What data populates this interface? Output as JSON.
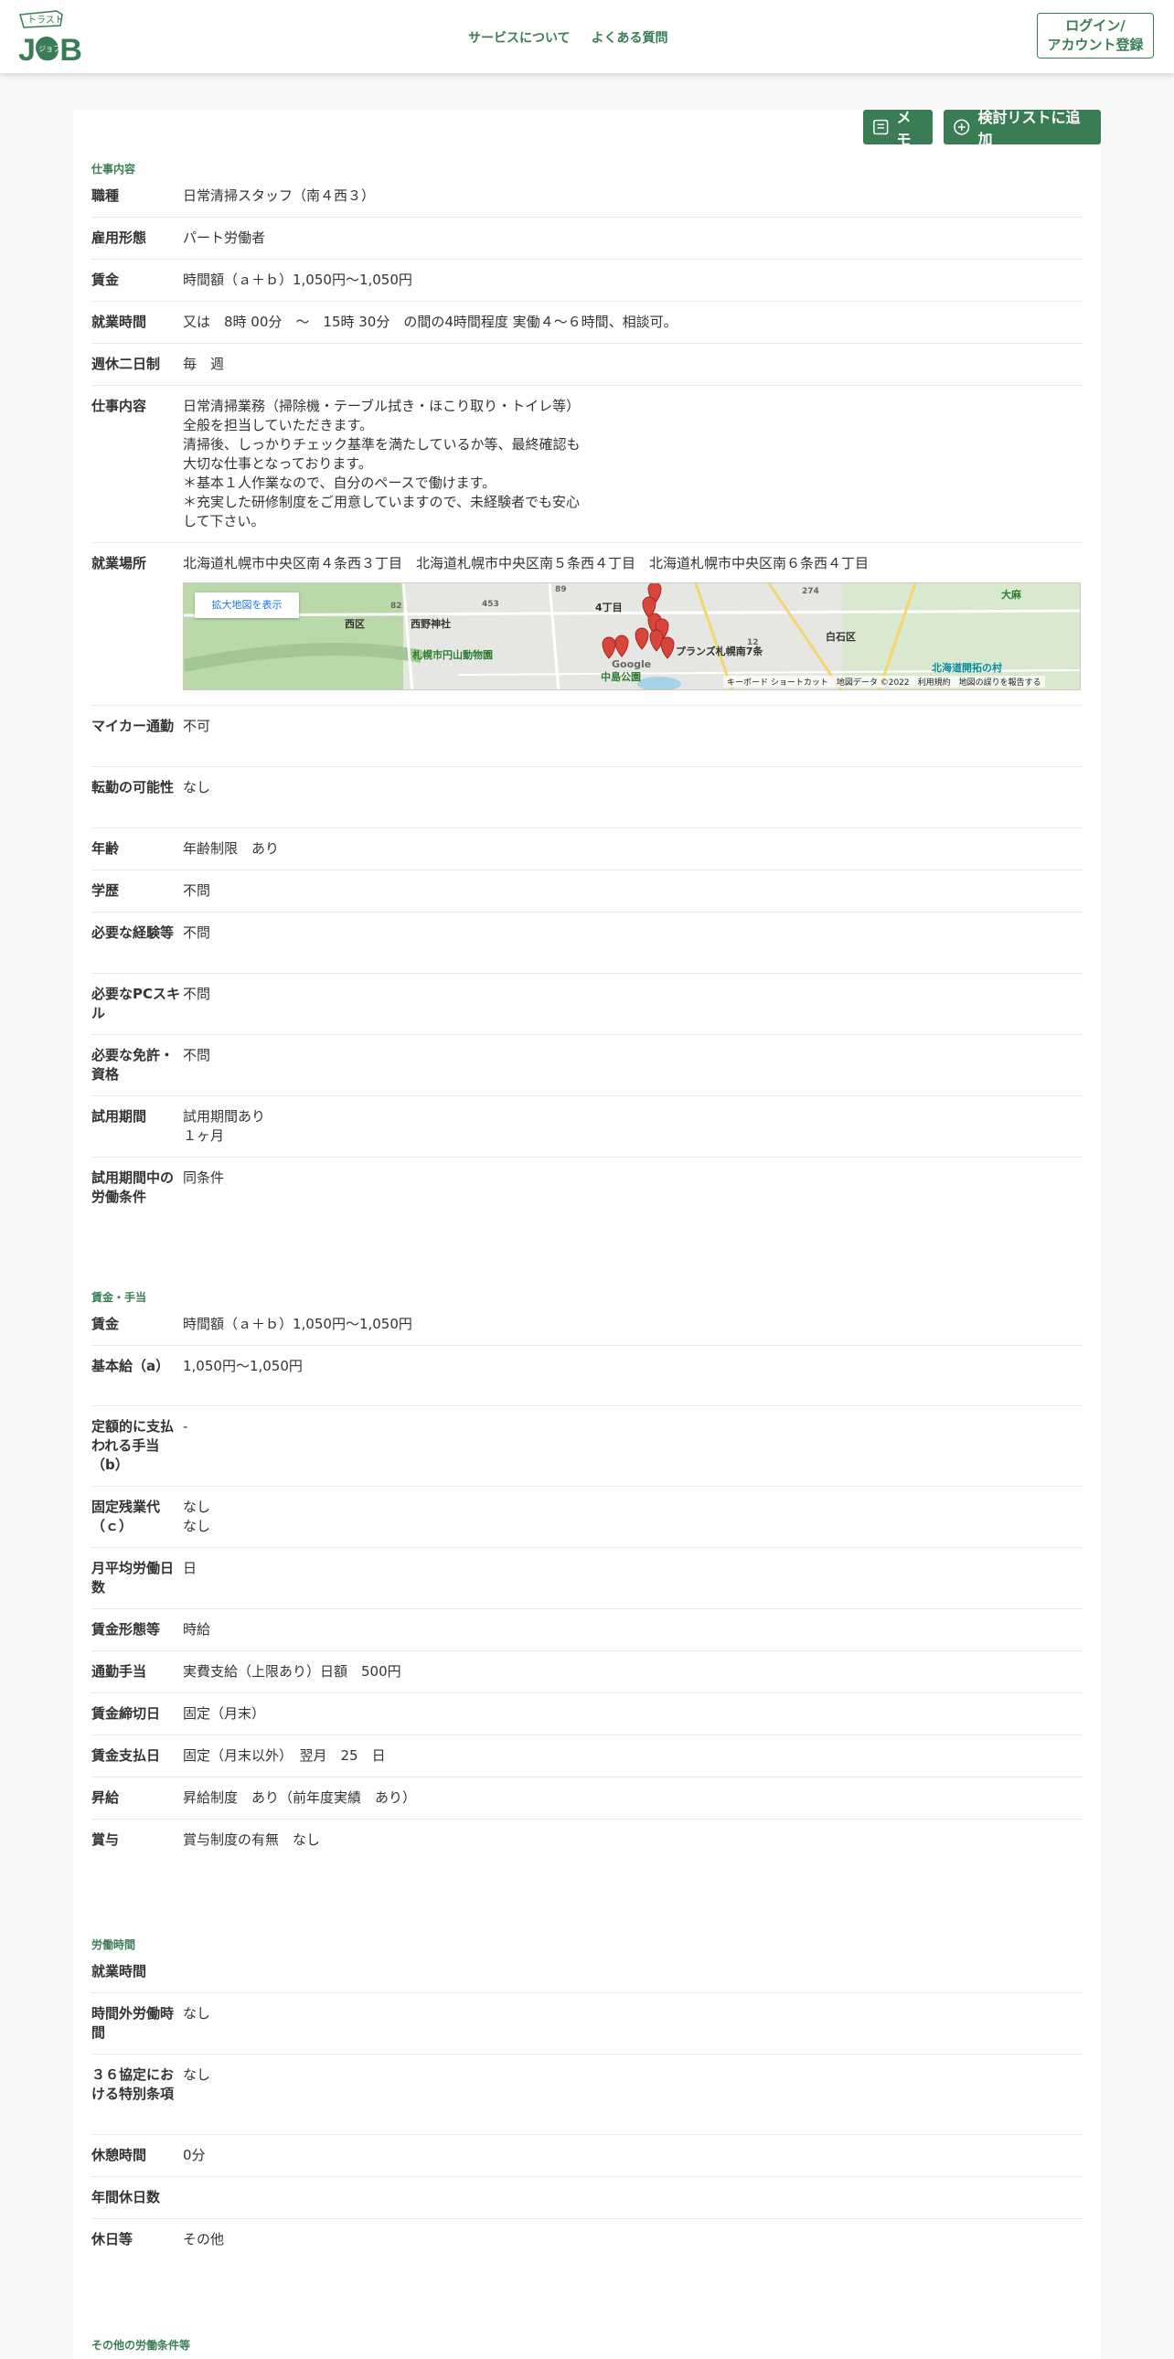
{
  "header": {
    "logo_top": "トラスト",
    "logo_main": "JOB",
    "logo_sub": "ジョブ",
    "nav": [
      "サービスについて",
      "よくある質問"
    ],
    "login_line1": "ログイン/",
    "login_line2": "アカウント登録"
  },
  "actions": {
    "memo_label": "メモ",
    "add_list_label": "検討リストに追加"
  },
  "colors": {
    "brand": "#3a7d54",
    "pin": "#d9453a"
  },
  "sections": [
    {
      "title": "仕事内容",
      "rows": [
        {
          "label": "職種",
          "value": "日常清掃スタッフ（南４西３）"
        },
        {
          "label": "雇用形態",
          "value": "パート労働者"
        },
        {
          "label": "賃金",
          "value": "時間額（ａ＋ｂ）1,050円～1,050円"
        },
        {
          "label": "就業時間",
          "value": "又は　8時 00分　～　15時 30分　の間の4時間程度 実働４～６時間、相談可。"
        },
        {
          "label": "週休二日制",
          "value": "毎　週"
        },
        {
          "label": "仕事内容",
          "value": "日常清掃業務（掃除機・テーブル拭き・ほこり取り・トイレ等）\n全般を担当していただきます。\n清掃後、しっかりチェック基準を満たしているか等、最終確認も\n大切な仕事となっております。\n＊基本１人作業なので、自分のペースで働けます。\n＊充実した研修制度をご用意していますので、未経験者でも安心\nして下さい。"
        },
        {
          "label": "就業場所",
          "value": "北海道札幌市中央区南４条西３丁目　北海道札幌市中央区南５条西４丁目　北海道札幌市中央区南６条西４丁目",
          "map": true
        },
        {
          "label": "マイカー通勤",
          "value": "不可"
        },
        {
          "label": "転勤の可能性",
          "value": "なし"
        },
        {
          "label": "年齢",
          "value": "年齢制限　あり"
        },
        {
          "label": "学歴",
          "value": "不問"
        },
        {
          "label": "必要な経験等",
          "value": "不問"
        },
        {
          "label": "必要なPCスキル",
          "value": "不問"
        },
        {
          "label": "必要な免許・資格",
          "value": "不問"
        },
        {
          "label": "試用期間",
          "value": "試用期間あり\n１ヶ月"
        },
        {
          "label": "試用期間中の労働条件",
          "value": "同条件"
        }
      ]
    },
    {
      "title": "賃金・手当",
      "rows": [
        {
          "label": "賃金",
          "value": "時間額（ａ＋ｂ）1,050円～1,050円"
        },
        {
          "label": "基本給（a）",
          "value": "1,050円～1,050円"
        },
        {
          "label": "定額的に支払われる手当（b）",
          "value": "-"
        },
        {
          "label": "固定残業代（ｃ）",
          "value": "なし\nなし"
        },
        {
          "label": "月平均労働日数",
          "value": "日"
        },
        {
          "label": "賃金形態等",
          "value": "時給"
        },
        {
          "label": "通勤手当",
          "value": "実費支給（上限あり）日額　500円"
        },
        {
          "label": "賃金締切日",
          "value": "固定（月末）"
        },
        {
          "label": "賃金支払日",
          "value": "固定（月末以外）　翌月　25　日"
        },
        {
          "label": "昇給",
          "value": "昇給制度　あり（前年度実績　あり）"
        },
        {
          "label": "賞与",
          "value": "賞与制度の有無　なし"
        }
      ]
    },
    {
      "title": "労働時間",
      "rows": [
        {
          "label": "就業時間",
          "value": ""
        },
        {
          "label": "時間外労働時間",
          "value": "なし"
        },
        {
          "label": "３６協定における特別条項",
          "value": "なし"
        },
        {
          "label": "休憩時間",
          "value": "0分"
        },
        {
          "label": "年間休日数",
          "value": ""
        },
        {
          "label": "休日等",
          "value": "その他"
        }
      ]
    },
    {
      "title": "その他の労働条件等",
      "rows": []
    }
  ],
  "map": {
    "link_label": "拡大地図を表示",
    "labels": [
      "西区",
      "西野神社",
      "札幌市円山動物園",
      "中島公園",
      "4丁目",
      "プランズ札幌南7条",
      "白石区",
      "大麻",
      "北海道開拓の村",
      "Google"
    ],
    "road_numbers": [
      "453",
      "82",
      "89",
      "274",
      "12"
    ],
    "footer": "キーボード ショートカット　地図データ ©2022　利用規約　地図の誤りを報告する"
  }
}
